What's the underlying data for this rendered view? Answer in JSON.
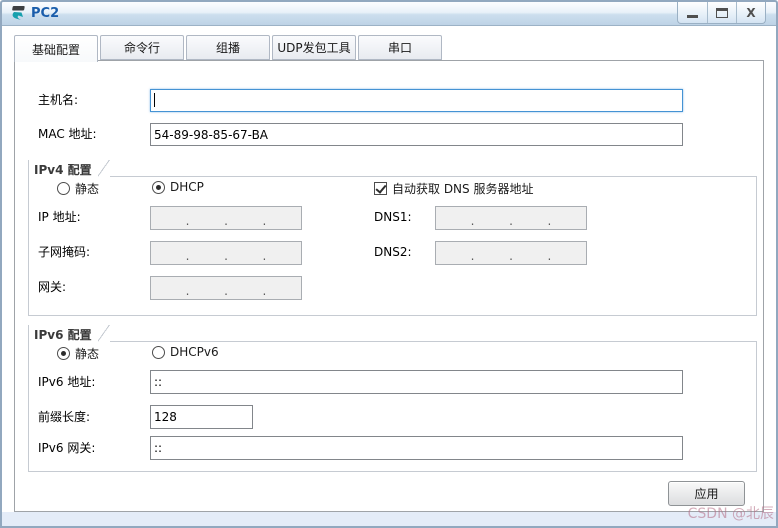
{
  "window": {
    "title": "PC2",
    "controls": {
      "minimize": "minimize",
      "maximize": "maximize",
      "close_glyph": "X"
    }
  },
  "tabs": [
    {
      "label": "基础配置",
      "active": true
    },
    {
      "label": "命令行",
      "active": false
    },
    {
      "label": "组播",
      "active": false
    },
    {
      "label": "UDP发包工具",
      "active": false
    },
    {
      "label": "串口",
      "active": false
    }
  ],
  "basic": {
    "hostname_label": "主机名:",
    "hostname_value": "",
    "mac_label": "MAC 地址:",
    "mac_value": "54-89-98-85-67-BA"
  },
  "ipv4": {
    "title": "IPv4 配置",
    "static_label": "静态",
    "dhcp_label": "DHCP",
    "mode": "DHCP",
    "dns_auto_label": "自动获取 DNS 服务器地址",
    "dns_auto_checked": true,
    "ip_label": "IP 地址:",
    "mask_label": "子网掩码:",
    "gateway_label": "网关:",
    "dns1_label": "DNS1:",
    "dns2_label": "DNS2:"
  },
  "ipv6": {
    "title": "IPv6 配置",
    "static_label": "静态",
    "dhcpv6_label": "DHCPv6",
    "mode": "静态",
    "address_label": "IPv6 地址:",
    "address_value": "::",
    "prefix_label": "前缀长度:",
    "prefix_value": "128",
    "gateway_label": "IPv6 网关:",
    "gateway_value": "::"
  },
  "footer": {
    "apply_label": "应用"
  },
  "watermark": "CSDN @北辰",
  "misc": {
    "dot": "."
  },
  "colors": {
    "title_text": "#1a5dab",
    "focus_border": "#4593d4",
    "frame": "#92a8bf"
  }
}
